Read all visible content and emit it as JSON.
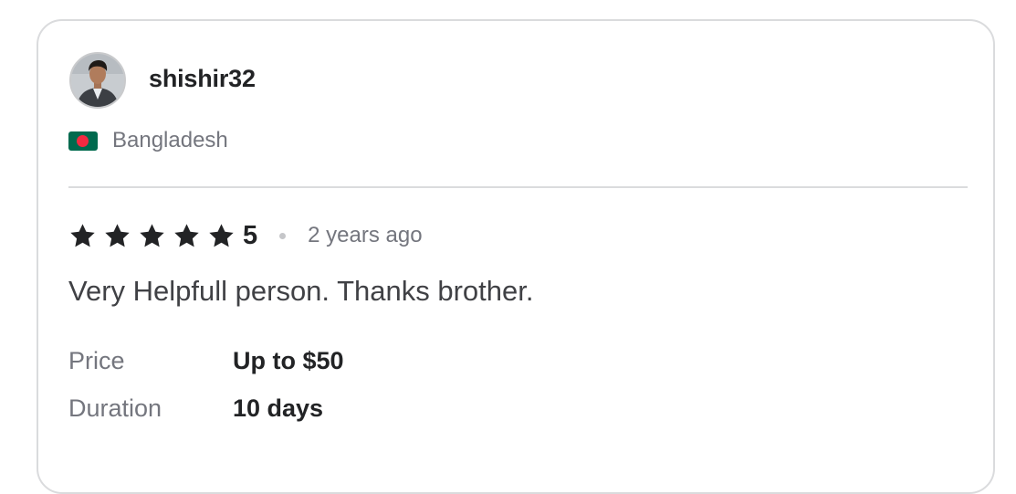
{
  "review": {
    "username": "shishir32",
    "country": "Bangladesh",
    "rating": {
      "stars_filled": 5,
      "stars_total": 5,
      "value": "5"
    },
    "time_ago": "2 years ago",
    "text": "Very Helpfull person. Thanks brother.",
    "details": {
      "price_label": "Price",
      "price_value": "Up to $50",
      "duration_label": "Duration",
      "duration_value": "10 days"
    }
  },
  "colors": {
    "star": "#222325",
    "flag_green": "#006a4e",
    "flag_red": "#f42a41",
    "border": "#dadbdd",
    "muted_text": "#74767e"
  },
  "icons": {
    "avatar": "user-avatar-photo",
    "flag": "bangladesh-flag-icon",
    "star": "star-icon"
  }
}
